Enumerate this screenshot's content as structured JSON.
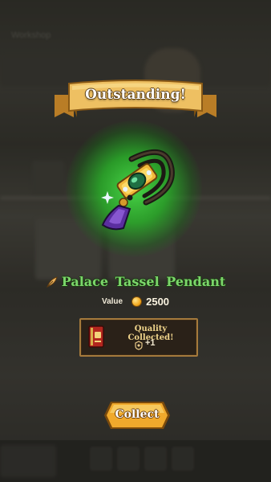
{
  "banner": {
    "text": "Outstanding!"
  },
  "item": {
    "name": "Palace Tassel Pendant",
    "icon": "pendant-icon"
  },
  "value": {
    "label": "Value",
    "amount": "2500",
    "icon": "coin-icon"
  },
  "quality": {
    "title": "Quality Collected!",
    "bonus": "+1",
    "book_icon": "quality-book-icon",
    "bonus_icon": "rank-icon"
  },
  "actions": {
    "collect_label": "Collect"
  },
  "background": {
    "title": "Workshop"
  },
  "colors": {
    "glow": "#3fd13f",
    "item_name": "#7bd66a",
    "banner": "#e8b54a",
    "button": "#f0a92c",
    "panel_border": "#a57a3c"
  }
}
